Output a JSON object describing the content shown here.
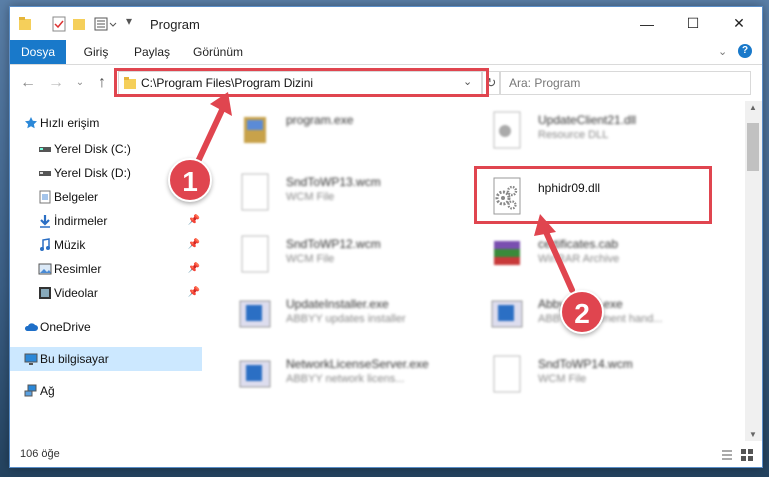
{
  "window": {
    "title": "Program",
    "controls": {
      "minimize": "—",
      "maximize": "☐",
      "close": "✕"
    }
  },
  "ribbon": {
    "tabs": [
      {
        "label": "Dosya",
        "active": true
      },
      {
        "label": "Giriş"
      },
      {
        "label": "Paylaş"
      },
      {
        "label": "Görünüm"
      }
    ]
  },
  "navigation": {
    "address": "C:\\Program Files\\Program Dizini",
    "search_placeholder": "Ara: Program"
  },
  "sidebar": {
    "items": [
      {
        "label": "Hızlı erişim",
        "icon": "star-icon"
      },
      {
        "label": "Yerel Disk (C:)",
        "icon": "drive-icon"
      },
      {
        "label": "Yerel Disk (D:)",
        "icon": "drive-icon"
      },
      {
        "label": "Belgeler",
        "icon": "documents-icon"
      },
      {
        "label": "İndirmeler",
        "icon": "download-icon"
      },
      {
        "label": "Müzik",
        "icon": "music-icon"
      },
      {
        "label": "Resimler",
        "icon": "pictures-icon"
      },
      {
        "label": "Videolar",
        "icon": "video-icon"
      },
      {
        "label": "OneDrive",
        "icon": "cloud-icon"
      },
      {
        "label": "Bu bilgisayar",
        "icon": "computer-icon"
      },
      {
        "label": "Ağ",
        "icon": "network-icon"
      }
    ]
  },
  "files": [
    {
      "name": "program.exe",
      "type": ""
    },
    {
      "name": "UpdateClient21.dll",
      "type": "Resource DLL"
    },
    {
      "name": "SndToWP13.wcm",
      "type": "WCM File"
    },
    {
      "name": "hphidr09.dll",
      "type": ""
    },
    {
      "name": "SndToWP12.wcm",
      "type": "WCM File"
    },
    {
      "name": "certificates.cab",
      "type": "WinRAR Archive"
    },
    {
      "name": "UpdateInstaller.exe",
      "type": "ABBYY updates installer"
    },
    {
      "name": "AbbyyHand.exe",
      "type": "ABBYY document hand..."
    },
    {
      "name": "NetworkLicenseServer.exe",
      "type": "ABBYY network licens..."
    },
    {
      "name": "SndToWP14.wcm",
      "type": "WCM File"
    }
  ],
  "status": {
    "item_count": "106 öğe"
  },
  "annotations": {
    "step1": "1",
    "step2": "2"
  },
  "colors": {
    "accent": "#1979ca",
    "highlight": "#e0454f",
    "selection": "#cce8ff"
  }
}
